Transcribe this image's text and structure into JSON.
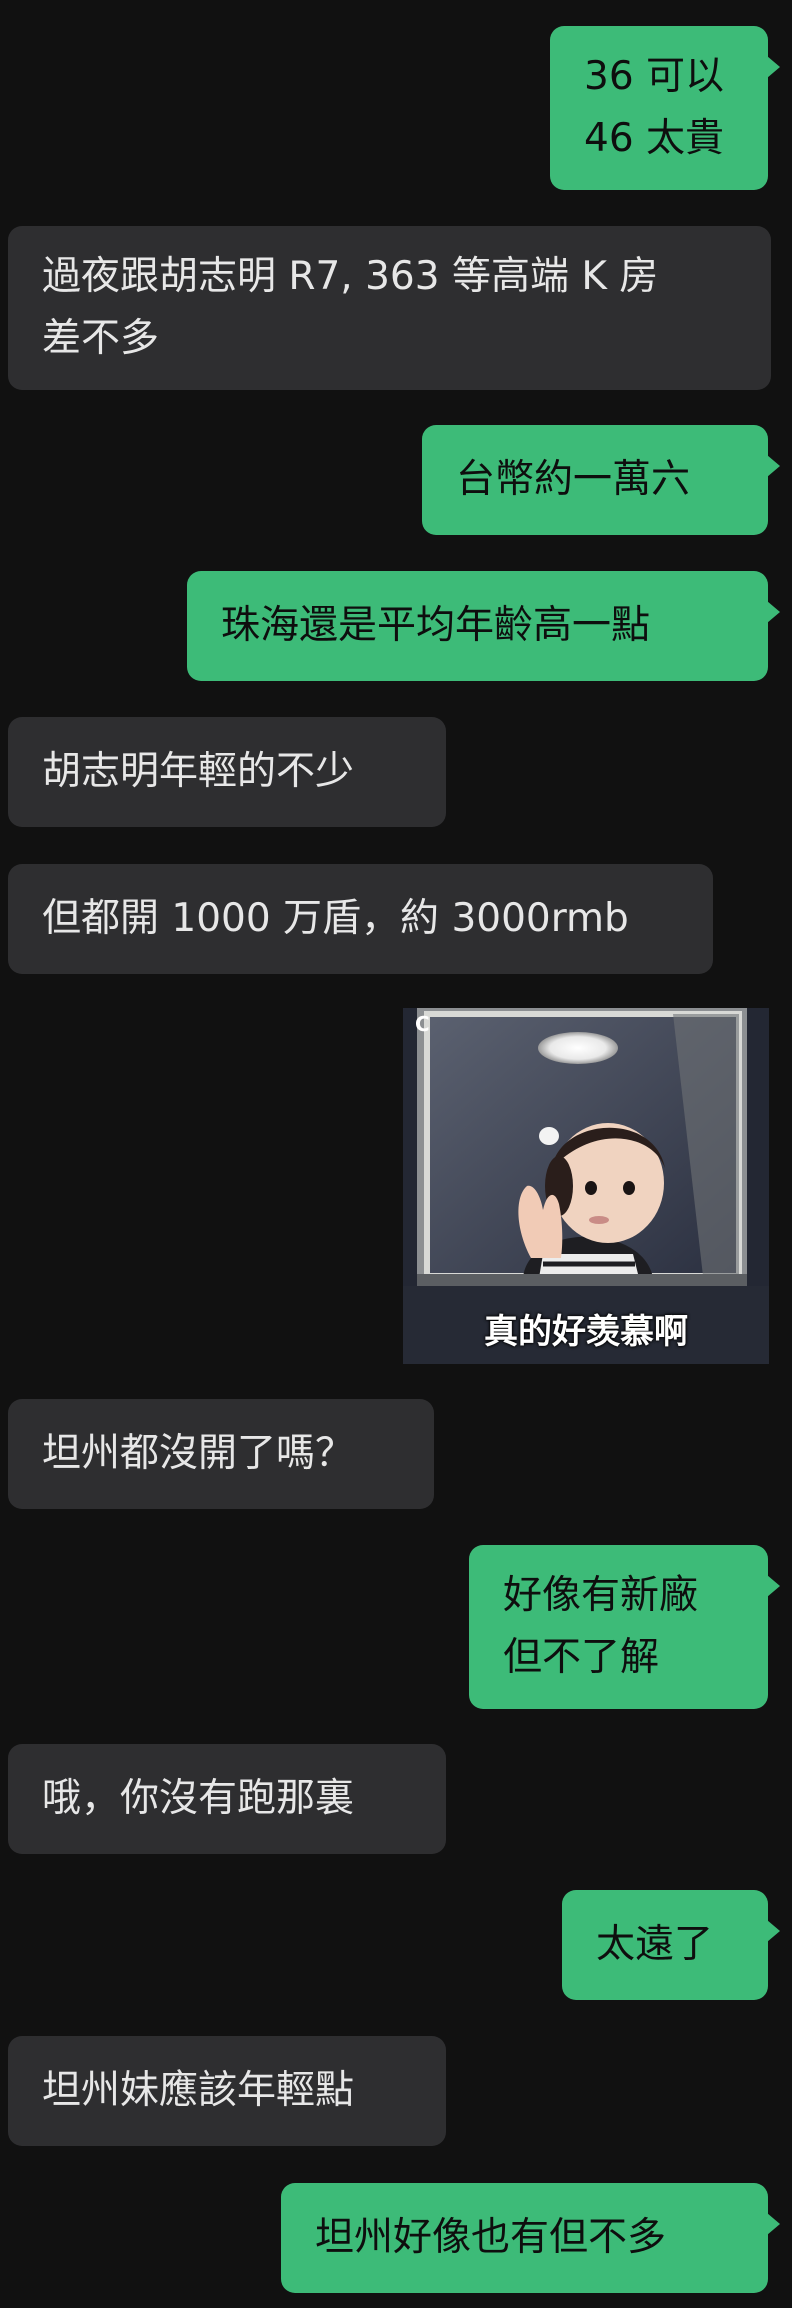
{
  "messages": [
    {
      "side": "out",
      "lines": [
        "36 可以",
        "46 太貴"
      ]
    },
    {
      "side": "in",
      "lines": [
        "過夜跟胡志明 R7, 363 等高端 K 房",
        "差不多"
      ]
    },
    {
      "side": "out",
      "lines": [
        "台幣約一萬六"
      ]
    },
    {
      "side": "out",
      "lines": [
        "珠海還是平均年齡高一點"
      ]
    },
    {
      "side": "in",
      "lines": [
        "胡志明年輕的不少"
      ]
    },
    {
      "side": "in",
      "lines": [
        "但都開 1000 万盾，約 3000rmb"
      ]
    },
    {
      "side": "out",
      "lines": [
        "坦州都沒開了嗎？"
      ]
    },
    {
      "side": "out",
      "lines": [
        "好像有新廠",
        "但不了解"
      ]
    },
    {
      "side": "in",
      "lines": [
        "哦，你沒有跑那裏"
      ]
    },
    {
      "side": "out",
      "lines": [
        "太遠了"
      ]
    },
    {
      "side": "in",
      "lines": [
        "坦州妹應該年輕點"
      ]
    },
    {
      "side": "out",
      "lines": [
        "坦州好像也有但不多"
      ]
    }
  ],
  "sticker": {
    "caption": "真的好羡慕啊",
    "corner_mark": "C",
    "description_icon": "child-at-window-sticker"
  }
}
